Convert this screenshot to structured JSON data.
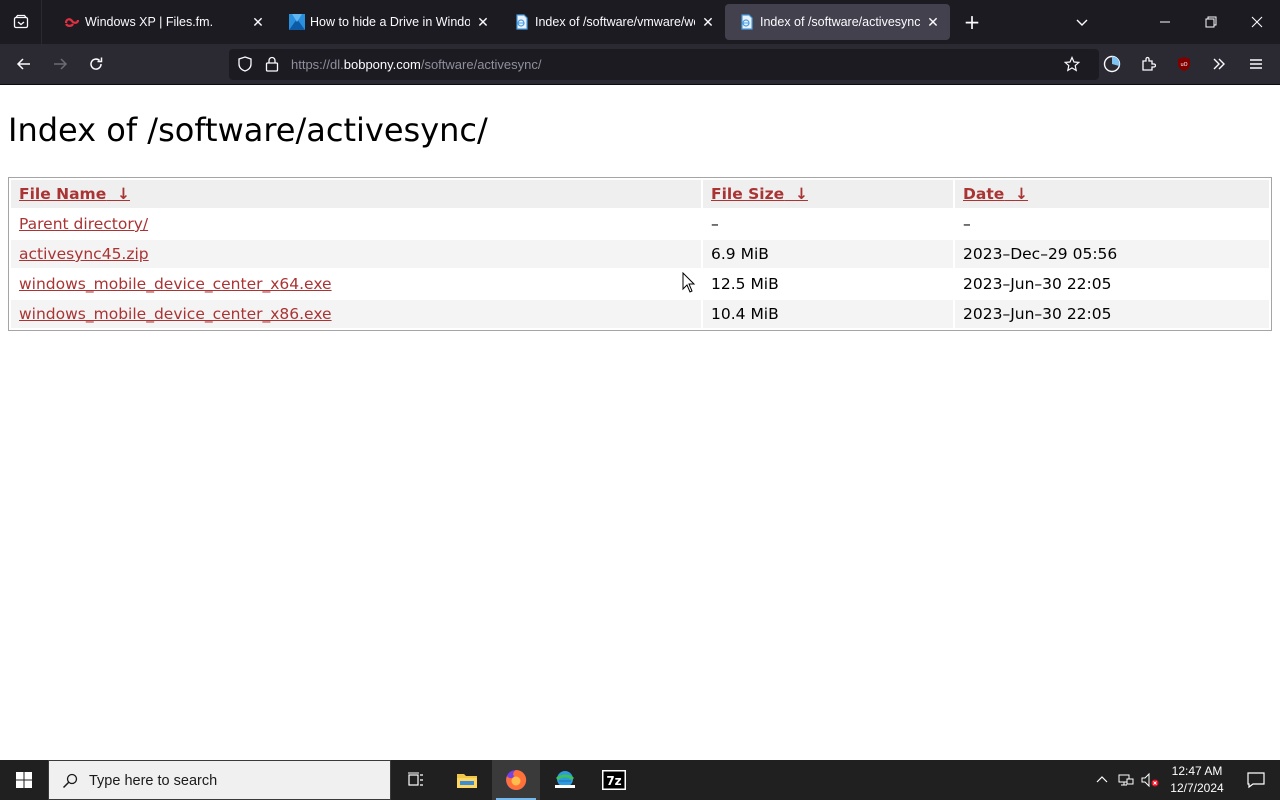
{
  "browser": {
    "tabs": [
      {
        "title": "Windows XP | Files.fm.",
        "icon": "filesfm-icon",
        "color": "#e03040"
      },
      {
        "title": "How to hide a Drive in Windows",
        "icon": "site-icon",
        "color": "#2a8fdd"
      },
      {
        "title": "Index of /software/vmware/wo",
        "icon": "document-icon",
        "color": "#4a9de0"
      },
      {
        "title": "Index of /software/activesync/",
        "icon": "document-icon",
        "color": "#4a9de0",
        "active": true
      }
    ],
    "url": {
      "prefix": "https://dl.",
      "host": "bobpony.com",
      "path": "/software/activesync/"
    }
  },
  "page": {
    "title": "Index of /software/activesync/",
    "columns": {
      "name": "File Name",
      "size": "File Size",
      "date": "Date",
      "sort_arrow": "↓"
    },
    "rows": [
      {
        "name": "Parent directory/",
        "size": "–",
        "date": "–"
      },
      {
        "name": "activesync45.zip",
        "size": "6.9 MiB",
        "date": "2023–Dec–29 05:56"
      },
      {
        "name": "windows_mobile_device_center_x64.exe",
        "size": "12.5 MiB",
        "date": "2023–Jun–30 22:05"
      },
      {
        "name": "windows_mobile_device_center_x86.exe",
        "size": "10.4 MiB",
        "date": "2023–Jun–30 22:05"
      }
    ],
    "link_color": "#aa3333"
  },
  "taskbar": {
    "search_placeholder": "Type here to search",
    "time": "12:47 AM",
    "date": "12/7/2024"
  }
}
